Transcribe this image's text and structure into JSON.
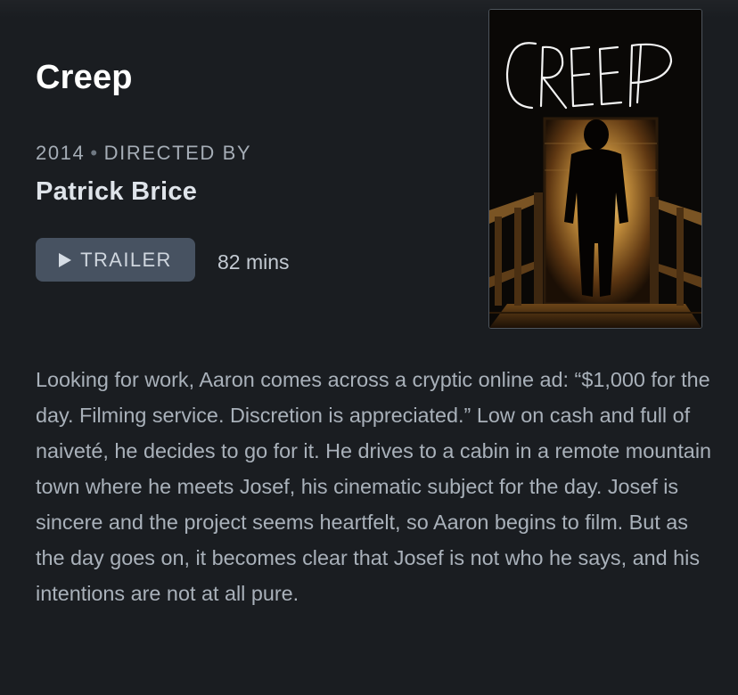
{
  "film": {
    "title": "Creep",
    "year": "2014",
    "separator": "•",
    "directed_by_label": "DIRECTED BY",
    "director": "Patrick Brice",
    "trailer_label": "TRAILER",
    "duration": "82 mins",
    "poster_title": "CREEP",
    "synopsis": "Looking for work, Aaron comes across a cryptic online ad: “$1,000 for the day. Filming service. Discretion is appreciated.” Low on cash and full of naiveté, he decides to go for it. He drives to a cabin in a remote mountain town where he meets Josef, his cinematic subject for the day. Josef is sincere and the project seems heartfelt, so Aaron begins to film. But as the day goes on, it becomes clear that Josef is not who he says, and his intentions are not at all pure."
  },
  "icons": {
    "trailer": "play-icon"
  },
  "colors": {
    "background": "#1a1d21",
    "title": "#ffffff",
    "meta": "#a5adb6",
    "button_bg": "#475261",
    "synopsis": "#a9b1ba"
  }
}
